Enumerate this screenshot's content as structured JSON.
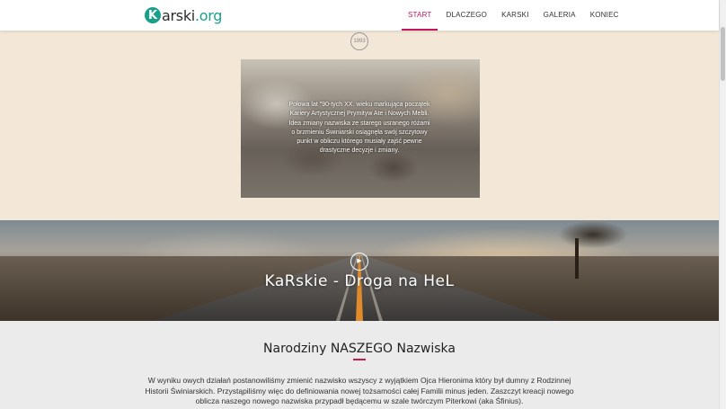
{
  "header": {
    "logo": {
      "mark": "K",
      "text_main": "arski",
      "text_accent": ".org"
    },
    "nav": [
      {
        "label": "START",
        "active": true
      },
      {
        "label": "DLACZEGO",
        "active": false
      },
      {
        "label": "KARSKI",
        "active": false
      },
      {
        "label": "GALERIA",
        "active": false
      },
      {
        "label": "KONIEC",
        "active": false
      }
    ]
  },
  "timeline": {
    "year": "1993",
    "text": "Połowa lat \"90-tych XX. wieku markująca początek Kariery Artystycznej Prymityw Ate i Nowych Mebli. Idea zmiany nazwiska ze starego usranego różami o brzmieniu Świniarski osiągnęła swój szczytowy punkt w obliczu którego musiały zajść pewne drastyczne decyzje i zmiany."
  },
  "video": {
    "title": "KaRskie - Droga na HeL",
    "play_icon": "play-icon"
  },
  "birth": {
    "heading": "Narodziny NASZEGO Nazwiska",
    "text": "W wyniku owych działań postanowiliśmy zmienić nazwisko wszyscy z wyjątkiem Ojca Hieronima który był dumny z Rodzinnej Historii Świniarskich. Przystąpiliśmy więc do definiowania nowej tożsamości całej Familii minus jeden. Zaszczyt kreacji nowego oblicza naszego nowego nazwiska przypadł będącemu w szale twórczym Piterkowi (aka Śfinius)."
  },
  "colors": {
    "brand": "#1aa08a",
    "accent": "#c2185b",
    "beige": "#f3e8d7"
  }
}
